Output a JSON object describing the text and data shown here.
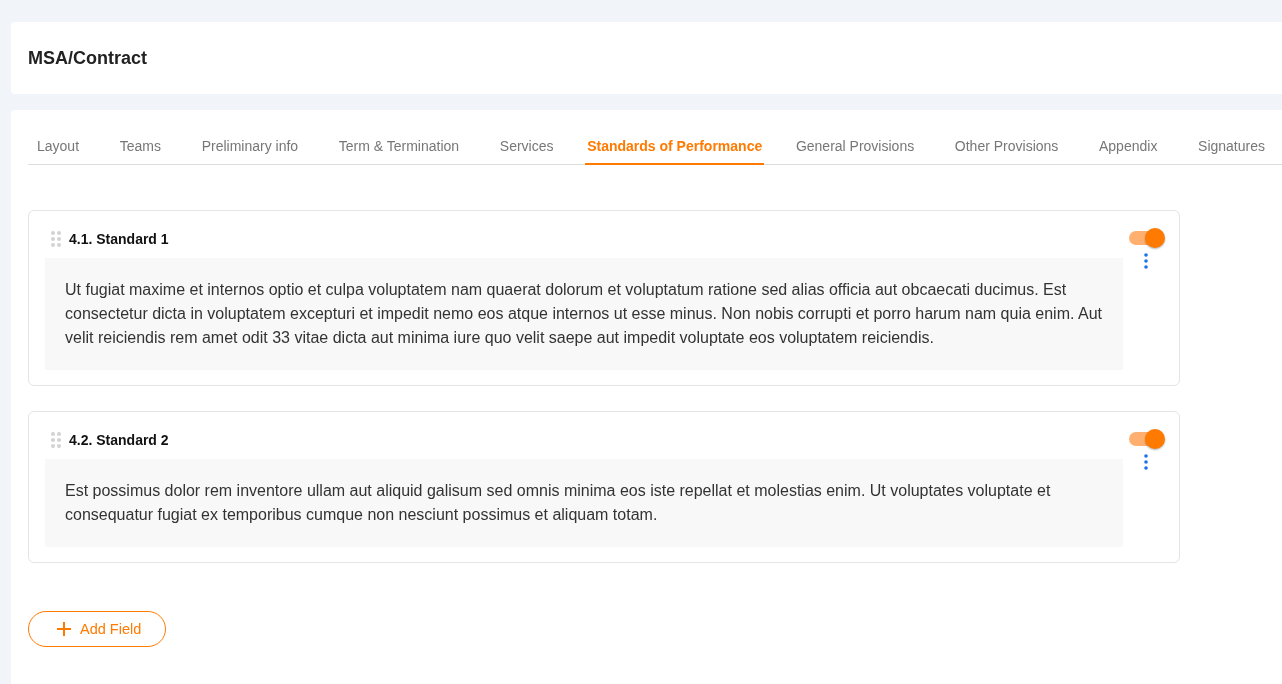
{
  "header": {
    "title": "MSA/Contract"
  },
  "tabs": [
    {
      "label": "Layout",
      "selected": false
    },
    {
      "label": "Teams",
      "selected": false
    },
    {
      "label": "Preliminary info",
      "selected": false
    },
    {
      "label": "Term & Termination",
      "selected": false
    },
    {
      "label": "Services",
      "selected": false
    },
    {
      "label": "Standards of Performance",
      "selected": true
    },
    {
      "label": "General Provisions",
      "selected": false
    },
    {
      "label": "Other Provisions",
      "selected": false
    },
    {
      "label": "Appendix",
      "selected": false
    },
    {
      "label": "Signatures",
      "selected": false
    }
  ],
  "fields": [
    {
      "title": "4.1. Standard 1",
      "on": true,
      "text": "Ut fugiat maxime et internos optio et culpa voluptatem nam quaerat dolorum et voluptatum ratione sed alias officia aut obcaecati ducimus. Est consectetur dicta in voluptatem excepturi et impedit nemo eos atque internos ut esse minus. Non nobis corrupti et porro harum nam quia enim. Aut velit reiciendis rem amet odit 33 vitae dicta aut minima iure quo velit saepe aut impedit voluptate eos voluptatem reiciendis."
    },
    {
      "title": "4.2. Standard 2",
      "on": true,
      "text": "Est possimus dolor rem inventore ullam aut aliquid galisum sed omnis minima eos iste repellat et molestias enim. Ut voluptates voluptate et consequatur fugiat ex temporibus cumque non nesciunt possimus et aliquam totam."
    }
  ],
  "add_button": {
    "label": "Add Field"
  }
}
